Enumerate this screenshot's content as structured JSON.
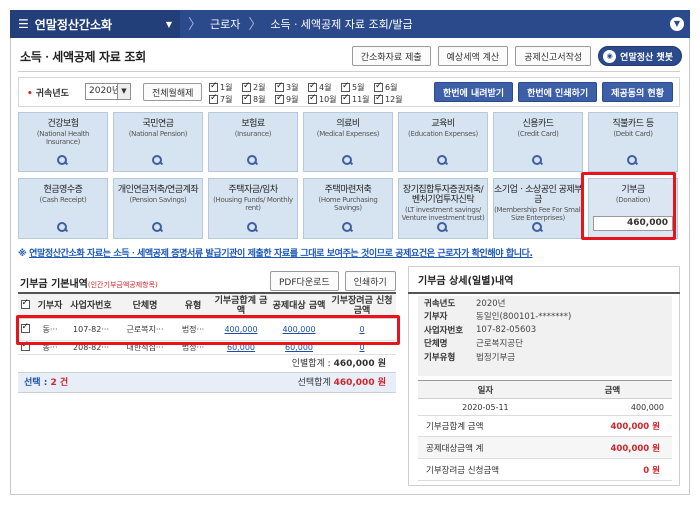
{
  "topbar": {
    "menu_label": "연말정산간소화",
    "crumbs": [
      "근로자",
      "소득ㆍ세액공제 자료 조회/발급"
    ]
  },
  "page": {
    "title": "소득ㆍ세액공제 자료 조회"
  },
  "top_buttons": [
    "간소화자료 제출",
    "예상세액 계산",
    "공제신고서작성",
    "연말정산 챗봇"
  ],
  "year_row": {
    "label": "귀속년도",
    "year": "2020년",
    "select_all": "전체월해제",
    "months": [
      "1월",
      "2월",
      "3월",
      "4월",
      "5월",
      "6월",
      "7월",
      "8월",
      "9월",
      "10월",
      "11월",
      "12월"
    ],
    "buttons": [
      "한번에 내려받기",
      "한번에 인쇄하기",
      "제공동의 현황"
    ]
  },
  "tiles": [
    {
      "t1": "건강보험",
      "t2": "(National Health Insurance)"
    },
    {
      "t1": "국민연금",
      "t2": "(National Pension)"
    },
    {
      "t1": "보험료",
      "t2": "(Insurance)"
    },
    {
      "t1": "의료비",
      "t2": "(Medical Expenses)"
    },
    {
      "t1": "교육비",
      "t2": "(Education Expenses)"
    },
    {
      "t1": "신용카드",
      "t2": "(Credit Card)"
    },
    {
      "t1": "직불카드 등",
      "t2": "(Debit Card)"
    },
    {
      "t1": "현금영수증",
      "t2": "(Cash Receipt)"
    },
    {
      "t1": "개인연금저축/연금계좌",
      "t2": "(Pension Savings)"
    },
    {
      "t1": "주택자금/임차",
      "t2": "(Housing Funds/ Monthly rent)"
    },
    {
      "t1": "주택마련저축",
      "t2": "(Home Purchasing Savings)"
    },
    {
      "t1": "장기집합투자증권저축/벤처기업투자신탁",
      "t2": "(LT investment savings/ Venture investment trust)"
    },
    {
      "t1": "소기업ㆍ소상공인 공제부금",
      "t2": "(Membership Fee For Small Size Enterprises)"
    },
    {
      "t1": "기부금",
      "t2": "(Donation)",
      "amount": "460,000"
    }
  ],
  "notice": {
    "prefix": "※ ",
    "underlined": "연말정산간소화 자료는 소득ㆍ세액공제 증명서류 발급기관이 제출한 자료를 그대로 보여주는 것이므로 공제요건은 근로자가 확인해야 합니다."
  },
  "left": {
    "title": "기부금 기본내역",
    "subtitle": "(인간기부금액공제항목)",
    "buttons": [
      "PDF다운로드",
      "인쇄하기"
    ],
    "columns": [
      "",
      "기부자",
      "사업자번호",
      "단체명",
      "유형",
      "기부금합계 금액",
      "공제대상 금액",
      "기부장려금 신청금액"
    ],
    "rows": [
      [
        "동···",
        "107-82···",
        "근로복지···",
        "법정···",
        "400,000",
        "400,000",
        "0"
      ],
      [
        "동···",
        "208-82···",
        "대한적십···",
        "법정···",
        "60,000",
        "60,000",
        "0"
      ]
    ],
    "sum_label": "인별합계 :",
    "sum_value": "460,000 원",
    "selected_label": "선택 :",
    "selected_count": "2 건",
    "selected_sum_label": "선택합계",
    "selected_sum_value": "460,000 원"
  },
  "right": {
    "title": "기부금 상세(일별)내역",
    "details": [
      {
        "k": "귀속년도",
        "v": "2020년"
      },
      {
        "k": "기부자",
        "v": "동일인(800101-*******)"
      },
      {
        "k": "사업자번호",
        "v": "107-82-05603"
      },
      {
        "k": "단체명",
        "v": "근로복지공단"
      },
      {
        "k": "기부유형",
        "v": "법정기부금"
      }
    ],
    "cols": [
      "일자",
      "금액"
    ],
    "rows": [
      [
        "2020-05-11",
        "400,000"
      ]
    ],
    "totals": [
      {
        "k": "기부금합계 금액",
        "v": "400,000 원"
      },
      {
        "k": "공제대상금액 계",
        "v": "400,000 원"
      },
      {
        "k": "기부장려금 신청금액",
        "v": "0 원"
      }
    ]
  },
  "colors": {
    "navy": "#2b4a8c",
    "tile": "#d6e3f0",
    "highlight": "#e8141b",
    "notice": "#1a57b8"
  }
}
